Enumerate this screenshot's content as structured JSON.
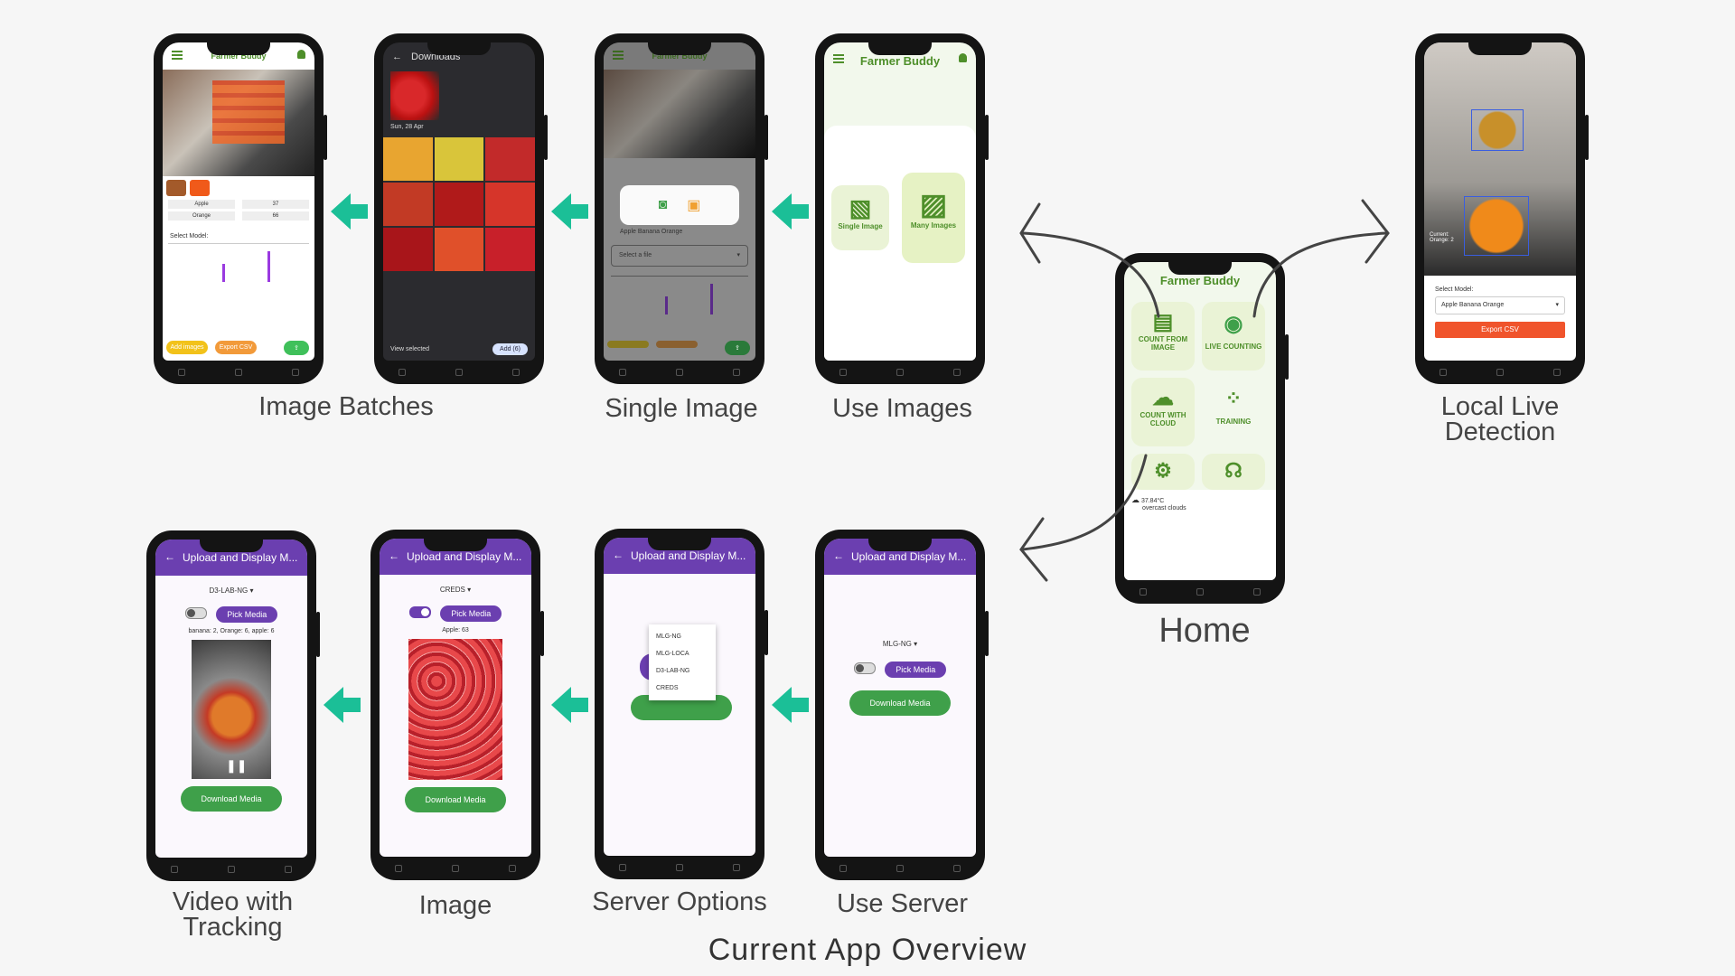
{
  "title": "Current App Overview",
  "captions": {
    "image_batches": "Image Batches",
    "single_image": "Single Image",
    "use_images": "Use Images",
    "home": "Home",
    "local_live_line1": "Local Live",
    "local_live_line2": "Detection",
    "video_line1": "Video with",
    "video_line2": "Tracking",
    "image": "Image",
    "server_options": "Server Options",
    "use_server": "Use Server"
  },
  "app_name": "Farmer Buddy",
  "home": {
    "tiles": [
      "COUNT FROM IMAGE",
      "LIVE COUNTING",
      "COUNT WITH CLOUD",
      "TRAINING"
    ],
    "temp": "37.84°C",
    "weather": "overcast clouds"
  },
  "use_images": {
    "single": "Single Image",
    "many": "Many Images"
  },
  "single_image": {
    "model": "Apple Banana Orange",
    "select_file": "Select a file"
  },
  "downloads": {
    "title": "Downloads",
    "date": "Sun, 28 Apr",
    "view_selected": "View selected",
    "add": "Add (6)"
  },
  "batches": {
    "rows": [
      {
        "label": "Apple",
        "value": "37"
      },
      {
        "label": "Orange",
        "value": "66"
      }
    ],
    "select_model": "Select Model:",
    "add_images": "Add images",
    "export": "Export CSV"
  },
  "live": {
    "select_model": "Select Model:",
    "model": "Apple Banana Orange",
    "export": "Export CSV",
    "current": "Current:",
    "orange": "Orange: 2"
  },
  "server": {
    "bar_title": "Upload and Display M...",
    "use_server_model": "MLG-NG",
    "pick_media": "Pick Media",
    "download_media": "Download Media",
    "options": [
      "MLG-NG",
      "MLG-LOCA",
      "D3-LAB-NG",
      "CREDS"
    ],
    "image_model": "CREDS",
    "image_result": "Apple: 63",
    "video_model": "D3-LAB-NG",
    "video_result": "banana: 2, Orange: 6, apple: 6"
  },
  "colors": {
    "teal_arrow": "#1bbf97",
    "purple": "#6b3fb0",
    "green": "#3fa04a",
    "export_red": "#f0542c"
  }
}
